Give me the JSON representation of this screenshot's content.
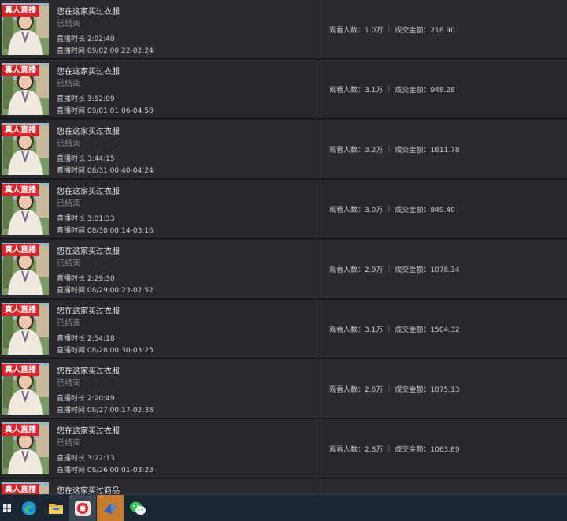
{
  "rows": [
    {
      "tag": "真人直播",
      "title": "您在这家买过衣服",
      "status": "已结束",
      "duration": "直播时长 2:02:40",
      "time": "直播时间 09/02 00:22-02:24",
      "viewers": "观看人数：1.0万",
      "amount": "成交金额：218.90"
    },
    {
      "tag": "真人直播",
      "title": "您在这家买过衣服",
      "status": "已结束",
      "duration": "直播时长 3:52:09",
      "time": "直播时间 09/01 01:06-04:58",
      "viewers": "观看人数：3.1万",
      "amount": "成交金额：948.28"
    },
    {
      "tag": "真人直播",
      "title": "您在这家买过衣服",
      "status": "已结束",
      "duration": "直播时长 3:44:15",
      "time": "直播时间 08/31 00:40-04:24",
      "viewers": "观看人数：3.2万",
      "amount": "成交金额：1611.78"
    },
    {
      "tag": "真人直播",
      "title": "您在这家买过衣服",
      "status": "已结束",
      "duration": "直播时长 3:01:33",
      "time": "直播时间 08/30 00:14-03:16",
      "viewers": "观看人数：3.0万",
      "amount": "成交金额：849.40"
    },
    {
      "tag": "真人直播",
      "title": "您在这家买过衣服",
      "status": "已结束",
      "duration": "直播时长 2:29:30",
      "time": "直播时间 08/29 00:23-02:52",
      "viewers": "观看人数：2.9万",
      "amount": "成交金额：1078.34"
    },
    {
      "tag": "真人直播",
      "title": "您在这家买过衣服",
      "status": "已结束",
      "duration": "直播时长 2:54:18",
      "time": "直播时间 08/28 00:30-03:25",
      "viewers": "观看人数：3.1万",
      "amount": "成交金额：1504.32"
    },
    {
      "tag": "真人直播",
      "title": "您在这家买过衣服",
      "status": "已结束",
      "duration": "直播时长 2:20:49",
      "time": "直播时间 08/27 00:17-02:38",
      "viewers": "观看人数：2.6万",
      "amount": "成交金额：1075.13"
    },
    {
      "tag": "真人直播",
      "title": "您在这家买过衣服",
      "status": "已结束",
      "duration": "直播时长 3:22:13",
      "time": "直播时间 08/26 00:01-03:23",
      "viewers": "观看人数：2.8万",
      "amount": "成交金额：1063.89"
    },
    {
      "tag": "真人直播",
      "title": "您在这家买过商品",
      "status": "",
      "duration": "",
      "time": "",
      "viewers": "",
      "amount": ""
    }
  ],
  "taskbar": {
    "items": [
      {
        "name": "windows-start-icon"
      },
      {
        "name": "edge-browser-icon"
      },
      {
        "name": "file-explorer-icon"
      },
      {
        "name": "red-app-icon",
        "active": true
      },
      {
        "name": "blue-app-icon",
        "active": true
      },
      {
        "name": "wechat-icon"
      }
    ]
  }
}
